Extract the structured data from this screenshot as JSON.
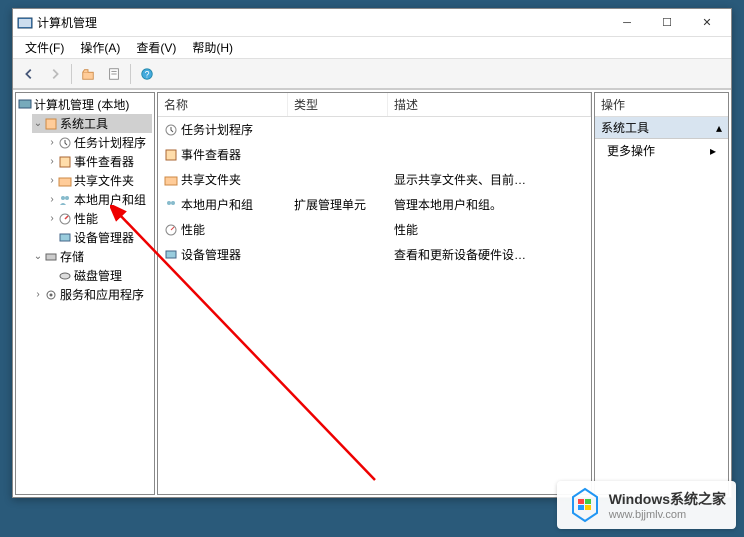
{
  "window": {
    "title": "计算机管理"
  },
  "menu": {
    "file": "文件(F)",
    "action": "操作(A)",
    "view": "查看(V)",
    "help": "帮助(H)"
  },
  "tree": {
    "root": "计算机管理 (本地)",
    "system_tools": "系统工具",
    "task_scheduler": "任务计划程序",
    "event_viewer": "事件查看器",
    "shared_folders": "共享文件夹",
    "local_users": "本地用户和组",
    "performance": "性能",
    "device_manager": "设备管理器",
    "storage": "存储",
    "disk_management": "磁盘管理",
    "services": "服务和应用程序"
  },
  "list": {
    "headers": {
      "name": "名称",
      "type": "类型",
      "description": "描述"
    },
    "rows": [
      {
        "name": "任务计划程序",
        "type": "",
        "desc": ""
      },
      {
        "name": "事件查看器",
        "type": "",
        "desc": ""
      },
      {
        "name": "共享文件夹",
        "type": "",
        "desc": "显示共享文件夹、目前…"
      },
      {
        "name": "本地用户和组",
        "type": "扩展管理单元",
        "desc": "管理本地用户和组。"
      },
      {
        "name": "性能",
        "type": "",
        "desc": "性能"
      },
      {
        "name": "设备管理器",
        "type": "",
        "desc": "查看和更新设备硬件设…"
      }
    ]
  },
  "actions": {
    "header": "操作",
    "group": "系统工具",
    "more": "更多操作"
  },
  "watermark": {
    "title": "Windows系统之家",
    "url": "www.bjjmlv.com"
  }
}
